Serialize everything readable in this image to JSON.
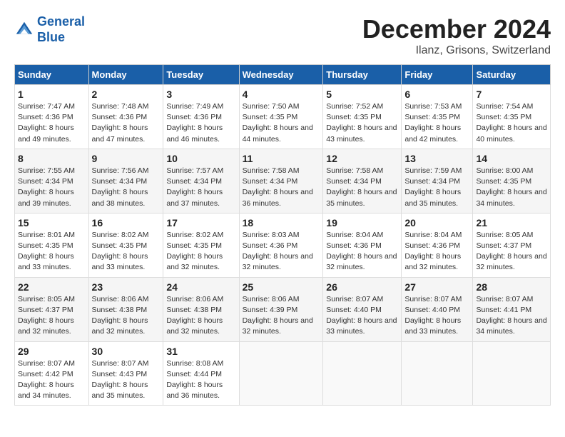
{
  "header": {
    "logo_line1": "General",
    "logo_line2": "Blue",
    "title": "December 2024",
    "subtitle": "Ilanz, Grisons, Switzerland"
  },
  "calendar": {
    "columns": [
      "Sunday",
      "Monday",
      "Tuesday",
      "Wednesday",
      "Thursday",
      "Friday",
      "Saturday"
    ],
    "weeks": [
      [
        {
          "day": "1",
          "rise": "7:47 AM",
          "set": "4:36 PM",
          "daylight": "8 hours and 49 minutes."
        },
        {
          "day": "2",
          "rise": "7:48 AM",
          "set": "4:36 PM",
          "daylight": "8 hours and 47 minutes."
        },
        {
          "day": "3",
          "rise": "7:49 AM",
          "set": "4:36 PM",
          "daylight": "8 hours and 46 minutes."
        },
        {
          "day": "4",
          "rise": "7:50 AM",
          "set": "4:35 PM",
          "daylight": "8 hours and 44 minutes."
        },
        {
          "day": "5",
          "rise": "7:52 AM",
          "set": "4:35 PM",
          "daylight": "8 hours and 43 minutes."
        },
        {
          "day": "6",
          "rise": "7:53 AM",
          "set": "4:35 PM",
          "daylight": "8 hours and 42 minutes."
        },
        {
          "day": "7",
          "rise": "7:54 AM",
          "set": "4:35 PM",
          "daylight": "8 hours and 40 minutes."
        }
      ],
      [
        {
          "day": "8",
          "rise": "7:55 AM",
          "set": "4:34 PM",
          "daylight": "8 hours and 39 minutes."
        },
        {
          "day": "9",
          "rise": "7:56 AM",
          "set": "4:34 PM",
          "daylight": "8 hours and 38 minutes."
        },
        {
          "day": "10",
          "rise": "7:57 AM",
          "set": "4:34 PM",
          "daylight": "8 hours and 37 minutes."
        },
        {
          "day": "11",
          "rise": "7:58 AM",
          "set": "4:34 PM",
          "daylight": "8 hours and 36 minutes."
        },
        {
          "day": "12",
          "rise": "7:58 AM",
          "set": "4:34 PM",
          "daylight": "8 hours and 35 minutes."
        },
        {
          "day": "13",
          "rise": "7:59 AM",
          "set": "4:34 PM",
          "daylight": "8 hours and 35 minutes."
        },
        {
          "day": "14",
          "rise": "8:00 AM",
          "set": "4:35 PM",
          "daylight": "8 hours and 34 minutes."
        }
      ],
      [
        {
          "day": "15",
          "rise": "8:01 AM",
          "set": "4:35 PM",
          "daylight": "8 hours and 33 minutes."
        },
        {
          "day": "16",
          "rise": "8:02 AM",
          "set": "4:35 PM",
          "daylight": "8 hours and 33 minutes."
        },
        {
          "day": "17",
          "rise": "8:02 AM",
          "set": "4:35 PM",
          "daylight": "8 hours and 32 minutes."
        },
        {
          "day": "18",
          "rise": "8:03 AM",
          "set": "4:36 PM",
          "daylight": "8 hours and 32 minutes."
        },
        {
          "day": "19",
          "rise": "8:04 AM",
          "set": "4:36 PM",
          "daylight": "8 hours and 32 minutes."
        },
        {
          "day": "20",
          "rise": "8:04 AM",
          "set": "4:36 PM",
          "daylight": "8 hours and 32 minutes."
        },
        {
          "day": "21",
          "rise": "8:05 AM",
          "set": "4:37 PM",
          "daylight": "8 hours and 32 minutes."
        }
      ],
      [
        {
          "day": "22",
          "rise": "8:05 AM",
          "set": "4:37 PM",
          "daylight": "8 hours and 32 minutes."
        },
        {
          "day": "23",
          "rise": "8:06 AM",
          "set": "4:38 PM",
          "daylight": "8 hours and 32 minutes."
        },
        {
          "day": "24",
          "rise": "8:06 AM",
          "set": "4:38 PM",
          "daylight": "8 hours and 32 minutes."
        },
        {
          "day": "25",
          "rise": "8:06 AM",
          "set": "4:39 PM",
          "daylight": "8 hours and 32 minutes."
        },
        {
          "day": "26",
          "rise": "8:07 AM",
          "set": "4:40 PM",
          "daylight": "8 hours and 33 minutes."
        },
        {
          "day": "27",
          "rise": "8:07 AM",
          "set": "4:40 PM",
          "daylight": "8 hours and 33 minutes."
        },
        {
          "day": "28",
          "rise": "8:07 AM",
          "set": "4:41 PM",
          "daylight": "8 hours and 34 minutes."
        }
      ],
      [
        {
          "day": "29",
          "rise": "8:07 AM",
          "set": "4:42 PM",
          "daylight": "8 hours and 34 minutes."
        },
        {
          "day": "30",
          "rise": "8:07 AM",
          "set": "4:43 PM",
          "daylight": "8 hours and 35 minutes."
        },
        {
          "day": "31",
          "rise": "8:08 AM",
          "set": "4:44 PM",
          "daylight": "8 hours and 36 minutes."
        },
        null,
        null,
        null,
        null
      ]
    ]
  }
}
